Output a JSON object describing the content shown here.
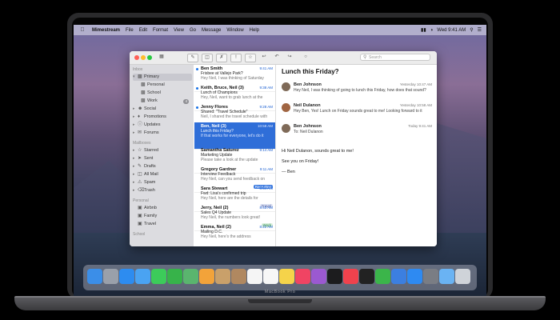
{
  "device": {
    "brand_label": "MacBook Pro"
  },
  "menubar": {
    "app_name": "Mimestream",
    "menus": [
      "File",
      "Edit",
      "Format",
      "View",
      "Go",
      "Message",
      "Window",
      "Help"
    ],
    "clock": "Wed 9:41 AM"
  },
  "mail": {
    "search_placeholder": "Search",
    "sidebar": {
      "inbox_header": "Inbox",
      "items": [
        {
          "label": "Primary",
          "icon": "inbox-icon",
          "selected": true,
          "indent": 1
        },
        {
          "label": "Personal",
          "icon": "inbox-icon",
          "indent": 2
        },
        {
          "label": "School",
          "icon": "inbox-icon",
          "indent": 2
        },
        {
          "label": "Work",
          "icon": "inbox-icon",
          "indent": 2,
          "count": "4"
        },
        {
          "label": "Social",
          "icon": "people-icon",
          "indent": 1
        },
        {
          "label": "Promotions",
          "icon": "tag-icon",
          "indent": 1
        },
        {
          "label": "Updates",
          "icon": "info-icon",
          "indent": 1
        },
        {
          "label": "Forums",
          "icon": "forum-icon",
          "indent": 1
        }
      ],
      "mailboxes_header": "Mailboxes",
      "mailboxes": [
        {
          "label": "Starred",
          "icon": "star-icon"
        },
        {
          "label": "Sent",
          "icon": "sent-icon"
        },
        {
          "label": "Drafts",
          "icon": "draft-icon"
        },
        {
          "label": "All Mail",
          "icon": "archive-icon"
        },
        {
          "label": "Spam",
          "icon": "spam-icon"
        },
        {
          "label": "Trash",
          "icon": "trash-icon"
        }
      ],
      "labels_header": "Personal",
      "labels": [
        {
          "label": "Airbnb",
          "icon": "label-icon"
        },
        {
          "label": "Family",
          "icon": "label-icon"
        },
        {
          "label": "Travel",
          "icon": "label-icon"
        }
      ],
      "footer_header": "School"
    },
    "messages": [
      {
        "from": "Ben Smith",
        "time": "9:41 AM",
        "subject": "Frisbee at Vallejo Park?",
        "preview": "Hey Neil, I was thinking of Saturday",
        "unread": true
      },
      {
        "from": "Keith, Bruce, Neil (3)",
        "time": "9:38 AM",
        "subject": "Lunch of Champions",
        "preview": "Hey, Neil, want to grab lunch at the",
        "unread": true
      },
      {
        "from": "Jenny Flores",
        "time": "9:28 AM",
        "subject": "Shared: \"Travel Schedule\"",
        "preview": "Neil, I shared the travel schedule with",
        "unread": true
      },
      {
        "from": "Ben, Neil (3)",
        "time": "10:58 AM",
        "subject": "Lunch this Friday?",
        "preview": "If that works for everyone, let's do it",
        "selected": true
      },
      {
        "from": "Samantha Saturez",
        "time": "9:14 AM",
        "subject": "Marketing Update",
        "preview": "Please take a look at the update",
        "unread": false
      },
      {
        "from": "Gregory Gardner",
        "time": "9:11 AM",
        "subject": "Interview Feedback",
        "preview": "Hey Neil, can you send feedback on",
        "tag": "Recruiting",
        "tag_color": "#3d7be0"
      },
      {
        "from": "Sara Stewart",
        "time": "8:54 AM",
        "subject": "Fwd: Lisa's confirmed trip",
        "preview": "Hey Neil, here are the details for",
        "tag": "Travel",
        "tag_color": "#7d8cc7"
      },
      {
        "from": "Jerry, Neil (2)",
        "time": "8:43 AM",
        "subject": "Sales Q4 Update",
        "preview": "Hey Neil, the numbers look great!",
        "tag": "Work",
        "tag_color": "#3aa55a"
      },
      {
        "from": "Emma, Neil (2)",
        "time": "8:22 AM",
        "subject": "Mailing D.C.",
        "preview": "Hey Neil, here's the address"
      }
    ],
    "thread": {
      "title": "Lunch this Friday?",
      "entries": [
        {
          "name": "Ben Johnson",
          "text": "Hey Neil, I was thinking of going to lunch this Friday, how does that sound?",
          "date": "Yesterday 10:47 AM",
          "avatar_color": "#7f6a58"
        },
        {
          "name": "Neil Dulanon",
          "text": "Hey Ben, Yes! Lunch on Friday sounds great to me! Looking forward to it",
          "date": "Yesterday 10:58 AM",
          "avatar_color": "#a06542"
        },
        {
          "name": "Ben Johnson",
          "text": "To: Neil Dulanon",
          "date": "Today 9:41 AM",
          "avatar_color": "#7f6a58"
        }
      ],
      "body_lines": [
        "Hi Neil Dulanon, sounds great to me!",
        "See you on Friday!",
        "— Ben"
      ]
    }
  },
  "dock": {
    "apps": [
      {
        "name": "finder-icon",
        "color": "#3b8ee8"
      },
      {
        "name": "launchpad-icon",
        "color": "#9aa0aa"
      },
      {
        "name": "safari-icon",
        "color": "#2d8cf0"
      },
      {
        "name": "mail-icon",
        "color": "#4aa3f2"
      },
      {
        "name": "messages-icon",
        "color": "#3ccb5a"
      },
      {
        "name": "facetime-icon",
        "color": "#37b34a"
      },
      {
        "name": "maps-icon",
        "color": "#5ab56e"
      },
      {
        "name": "photos-icon",
        "color": "#f2a33a"
      },
      {
        "name": "notes-icon",
        "color": "#c9a06a"
      },
      {
        "name": "contacts-icon",
        "color": "#b08860"
      },
      {
        "name": "calendar-icon",
        "color": "#f5f5f5"
      },
      {
        "name": "reminders-icon",
        "color": "#f7f7f7"
      },
      {
        "name": "notes-app-icon",
        "color": "#f5d34a"
      },
      {
        "name": "music-icon",
        "color": "#f04463"
      },
      {
        "name": "podcasts-icon",
        "color": "#9b59d0"
      },
      {
        "name": "tv-icon",
        "color": "#1c1c1e"
      },
      {
        "name": "news-icon",
        "color": "#f0424d"
      },
      {
        "name": "stocks-icon",
        "color": "#222222"
      },
      {
        "name": "numbers-icon",
        "color": "#3bb54a"
      },
      {
        "name": "keynote-icon",
        "color": "#3c7fe0"
      },
      {
        "name": "app-store-icon",
        "color": "#2e8af2"
      },
      {
        "name": "system-preferences-icon",
        "color": "#7a7d84"
      },
      {
        "name": "downloads-folder-icon",
        "color": "#6ab3f3"
      },
      {
        "name": "trash-icon",
        "color": "#cfd3d9"
      }
    ]
  }
}
